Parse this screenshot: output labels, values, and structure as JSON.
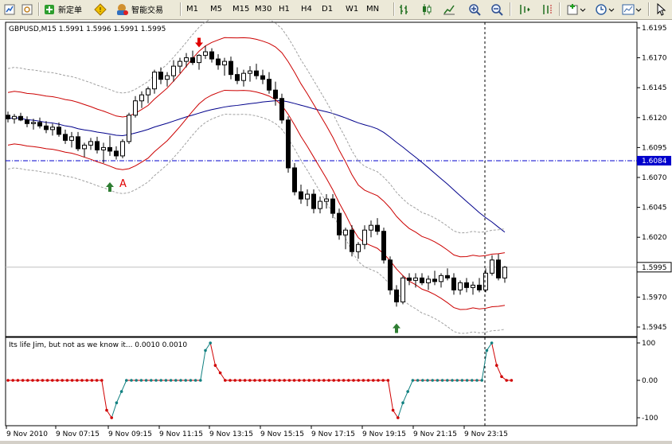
{
  "toolbar": {
    "new_order_label": "新定单",
    "expert_label": "智能交易",
    "timeframes": [
      "M1",
      "M5",
      "M15",
      "M30",
      "H1",
      "H4",
      "D1",
      "W1",
      "MN"
    ]
  },
  "main_chart": {
    "header": "GBPUSD,M15  1.5991 1.5996 1.5991 1.5995",
    "y_ticks": [
      "1.6195",
      "1.6170",
      "1.6145",
      "1.6120",
      "1.6095",
      "1.6070",
      "1.6045",
      "1.6020",
      "1.5995",
      "1.5970",
      "1.5945"
    ],
    "price_levels": [
      1.6195,
      1.617,
      1.6145,
      1.612,
      1.6095,
      1.607,
      1.6045,
      1.602,
      1.5995,
      1.597,
      1.5945
    ],
    "hline_label": "1.6084",
    "hline_price": 1.6084,
    "current_price_label": "1.5995",
    "current_price": 1.5995,
    "annotation": "A",
    "colors": {
      "bull": "#000000",
      "bear": "#000000",
      "hline": "#0000cc",
      "ma_blue": "#00008b",
      "env_red": "#cc0000",
      "env_gray": "#a0a0a0",
      "arrow_up": "#2e7d32",
      "arrow_down": "#e00000"
    }
  },
  "indicator": {
    "header": "Its life Jim, but not as we know it...  0.0010 0.0010",
    "y_ticks": [
      "100",
      "0.00",
      "-100"
    ],
    "values": [
      0,
      0,
      0,
      0,
      0,
      0,
      0,
      0,
      0,
      0,
      0,
      0,
      0,
      0,
      0,
      0,
      0,
      0,
      0,
      0,
      -0.8,
      -1,
      -0.6,
      -0.3,
      0,
      0,
      0,
      0,
      0,
      0,
      0,
      0,
      0,
      0,
      0,
      0,
      0,
      0,
      0,
      0,
      0.8,
      1,
      0.4,
      0.2,
      0,
      0,
      0,
      0,
      0,
      0,
      0,
      0,
      0,
      0,
      0,
      0,
      0,
      0,
      0,
      0,
      0,
      0,
      0,
      0,
      0,
      0,
      0,
      0,
      0,
      0,
      0,
      0,
      0,
      0,
      0,
      0,
      0,
      0,
      -0.8,
      -1,
      -0.6,
      -0.3,
      0,
      0,
      0,
      0,
      0,
      0,
      0,
      0,
      0,
      0,
      0,
      0,
      0,
      0,
      0,
      0.8,
      1,
      0.4,
      0.1,
      0,
      0
    ]
  },
  "x_axis": {
    "labels": [
      "9 Nov 2010",
      "9 Nov 07:15",
      "9 Nov 09:15",
      "9 Nov 11:15",
      "9 Nov 13:15",
      "9 Nov 15:15",
      "9 Nov 17:15",
      "9 Nov 19:15",
      "9 Nov 21:15",
      "9 Nov 23:15"
    ]
  },
  "candles": [
    [
      1.6122,
      1.6125,
      1.6116,
      1.6119
    ],
    [
      1.6119,
      1.6123,
      1.6115,
      1.6121
    ],
    [
      1.6121,
      1.6124,
      1.6117,
      1.6118
    ],
    [
      1.6118,
      1.6121,
      1.6112,
      1.6115
    ],
    [
      1.6115,
      1.6119,
      1.611,
      1.6116
    ],
    [
      1.6116,
      1.612,
      1.6111,
      1.6113
    ],
    [
      1.6113,
      1.6117,
      1.6107,
      1.611
    ],
    [
      1.611,
      1.6115,
      1.6105,
      1.6112
    ],
    [
      1.6112,
      1.6116,
      1.6104,
      1.6106
    ],
    [
      1.6106,
      1.611,
      1.6098,
      1.6101
    ],
    [
      1.6101,
      1.6108,
      1.6095,
      1.6104
    ],
    [
      1.6104,
      1.6108,
      1.6092,
      1.6094
    ],
    [
      1.6094,
      1.6099,
      1.6087,
      1.6097
    ],
    [
      1.6097,
      1.6103,
      1.6093,
      1.61
    ],
    [
      1.61,
      1.6104,
      1.609,
      1.6093
    ],
    [
      1.6093,
      1.6099,
      1.6082,
      1.6095
    ],
    [
      1.6095,
      1.6105,
      1.6088,
      1.6092
    ],
    [
      1.6092,
      1.6096,
      1.6085,
      1.6088
    ],
    [
      1.6088,
      1.6102,
      1.6086,
      1.61
    ],
    [
      1.61,
      1.6124,
      1.6098,
      1.6122
    ],
    [
      1.6122,
      1.6138,
      1.612,
      1.6134
    ],
    [
      1.6134,
      1.6142,
      1.6128,
      1.6139
    ],
    [
      1.6139,
      1.6146,
      1.6132,
      1.6144
    ],
    [
      1.6144,
      1.616,
      1.614,
      1.6158
    ],
    [
      1.6158,
      1.6162,
      1.6148,
      1.6152
    ],
    [
      1.6152,
      1.6158,
      1.6146,
      1.6155
    ],
    [
      1.6155,
      1.6168,
      1.615,
      1.6163
    ],
    [
      1.6163,
      1.617,
      1.6157,
      1.6167
    ],
    [
      1.6167,
      1.6174,
      1.6162,
      1.617
    ],
    [
      1.617,
      1.6176,
      1.6164,
      1.6166
    ],
    [
      1.6166,
      1.6173,
      1.616,
      1.6172
    ],
    [
      1.6172,
      1.618,
      1.6169,
      1.6175
    ],
    [
      1.6175,
      1.6178,
      1.6166,
      1.6169
    ],
    [
      1.6169,
      1.6173,
      1.616,
      1.6164
    ],
    [
      1.6164,
      1.617,
      1.6155,
      1.6167
    ],
    [
      1.6167,
      1.6171,
      1.6152,
      1.6156
    ],
    [
      1.6156,
      1.6162,
      1.6148,
      1.6151
    ],
    [
      1.6151,
      1.616,
      1.6146,
      1.6157
    ],
    [
      1.6157,
      1.6163,
      1.615,
      1.6159
    ],
    [
      1.6159,
      1.6165,
      1.6152,
      1.6155
    ],
    [
      1.6155,
      1.616,
      1.6148,
      1.6152
    ],
    [
      1.6152,
      1.6158,
      1.614,
      1.6143
    ],
    [
      1.6143,
      1.615,
      1.613,
      1.6136
    ],
    [
      1.6136,
      1.614,
      1.6115,
      1.6118
    ],
    [
      1.6118,
      1.6121,
      1.6074,
      1.6078
    ],
    [
      1.6078,
      1.6082,
      1.6055,
      1.6058
    ],
    [
      1.6058,
      1.6064,
      1.6048,
      1.6052
    ],
    [
      1.6052,
      1.606,
      1.6046,
      1.6056
    ],
    [
      1.6056,
      1.606,
      1.604,
      1.6044
    ],
    [
      1.6044,
      1.6054,
      1.604,
      1.605
    ],
    [
      1.605,
      1.6056,
      1.6044,
      1.6052
    ],
    [
      1.6052,
      1.6056,
      1.6036,
      1.604
    ],
    [
      1.604,
      1.6044,
      1.6018,
      1.6022
    ],
    [
      1.6022,
      1.6028,
      1.601,
      1.6026
    ],
    [
      1.6026,
      1.603,
      1.6004,
      1.6008
    ],
    [
      1.6008,
      1.6016,
      1.6002,
      1.6014
    ],
    [
      1.6014,
      1.603,
      1.601,
      1.6026
    ],
    [
      1.6026,
      1.6034,
      1.602,
      1.603
    ],
    [
      1.603,
      1.6036,
      1.6022,
      1.6025
    ],
    [
      1.6025,
      1.6028,
      1.5998,
      1.6001
    ],
    [
      1.6001,
      1.6004,
      1.5972,
      1.5976
    ],
    [
      1.5976,
      1.598,
      1.5962,
      1.5966
    ],
    [
      1.5966,
      1.5988,
      1.5964,
      1.5986
    ],
    [
      1.5986,
      1.599,
      1.598,
      1.5984
    ],
    [
      1.5984,
      1.599,
      1.5978,
      1.5986
    ],
    [
      1.5986,
      1.599,
      1.598,
      1.5982
    ],
    [
      1.5982,
      1.5988,
      1.5976,
      1.5985
    ],
    [
      1.5985,
      1.5992,
      1.598,
      1.5983
    ],
    [
      1.5983,
      1.599,
      1.5978,
      1.5988
    ],
    [
      1.5988,
      1.5994,
      1.5984,
      1.5986
    ],
    [
      1.5986,
      1.599,
      1.5972,
      1.5976
    ],
    [
      1.5976,
      1.5984,
      1.5972,
      1.5982
    ],
    [
      1.5982,
      1.5986,
      1.5974,
      1.5978
    ],
    [
      1.5978,
      1.5983,
      1.5972,
      1.598
    ],
    [
      1.598,
      1.5986,
      1.5974,
      1.5976
    ],
    [
      1.5976,
      1.5994,
      1.5974,
      1.599
    ],
    [
      1.599,
      1.6005,
      1.5988,
      1.6001
    ],
    [
      1.6001,
      1.6006,
      1.5984,
      1.5986
    ],
    [
      1.5986,
      1.5996,
      1.5982,
      1.5995
    ]
  ]
}
